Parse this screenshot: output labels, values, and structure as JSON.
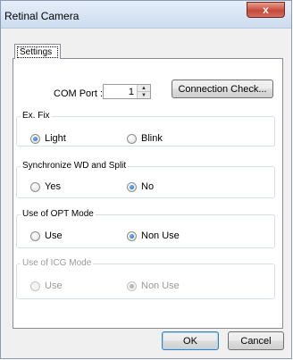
{
  "window": {
    "title": "Retinal Camera",
    "close_label": "x"
  },
  "tabs": [
    {
      "label": "Settings"
    }
  ],
  "com_port": {
    "label": "COM Port :",
    "value": "1",
    "up_glyph": "▲",
    "down_glyph": "▼"
  },
  "connection_check": {
    "label": "Connection Check..."
  },
  "groups": {
    "ex_fix": {
      "title": "Ex. Fix",
      "options": [
        "Light",
        "Blink"
      ],
      "selected": "Light"
    },
    "sync": {
      "title": "Synchronize WD and Split",
      "options": [
        "Yes",
        "No"
      ],
      "selected": "No"
    },
    "opt_mode": {
      "title": "Use of OPT Mode",
      "options": [
        "Use",
        "Non Use"
      ],
      "selected": "Non Use"
    },
    "icg_mode": {
      "title": "Use of ICG Mode",
      "options": [
        "Use",
        "Non Use"
      ],
      "selected": "Non Use",
      "enabled": false
    }
  },
  "footer": {
    "ok_label": "OK",
    "cancel_label": "Cancel"
  }
}
